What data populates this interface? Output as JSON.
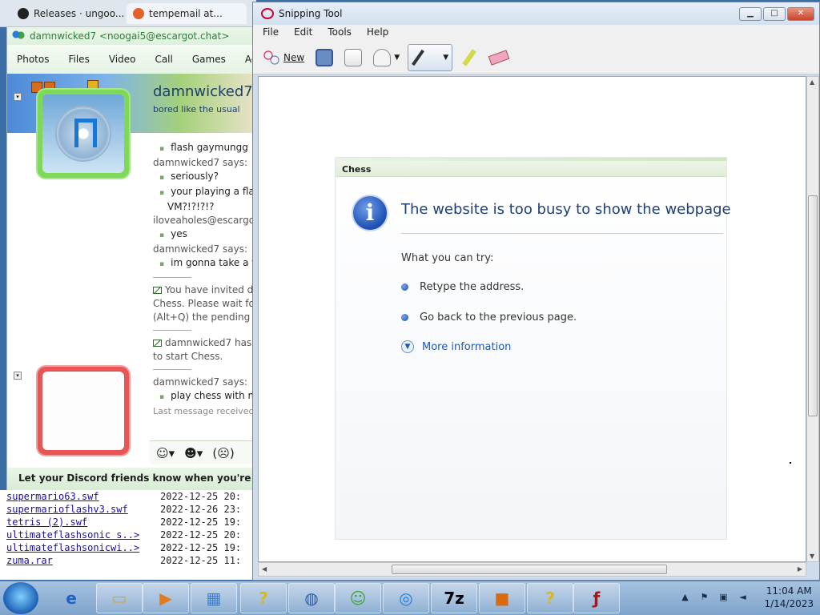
{
  "browser": {
    "tabs": [
      {
        "label": "Releases · ungoo...",
        "icon": "github-icon"
      },
      {
        "label": "tempemail at...",
        "icon": "extension-icon"
      }
    ]
  },
  "messenger": {
    "title": "damnwicked7 <noogai5@escargot.chat>",
    "menu": [
      "Photos",
      "Files",
      "Video",
      "Call",
      "Games",
      "Activ"
    ],
    "display_name": "damnwicked7",
    "status_message": "bored like the usual",
    "chat": [
      {
        "kind": "bullet",
        "text": "flash gaymungg"
      },
      {
        "kind": "sender",
        "text": "damnwicked7 says:"
      },
      {
        "kind": "bullet",
        "text": "seriously?"
      },
      {
        "kind": "bullet",
        "text": "your playing a flas"
      },
      {
        "kind": "cont",
        "text": "VM?!?!?!?"
      },
      {
        "kind": "sender",
        "text": "iloveaholes@escargo"
      },
      {
        "kind": "bullet",
        "text": "yes"
      },
      {
        "kind": "sender",
        "text": "damnwicked7 says:"
      },
      {
        "kind": "bullet",
        "text": "im gonna take a fu"
      },
      {
        "kind": "sep"
      },
      {
        "kind": "system",
        "text": "You have invited d"
      },
      {
        "kind": "syscont",
        "text": "Chess. Please wait for"
      },
      {
        "kind": "syscont",
        "text": "(Alt+Q) the pending i"
      },
      {
        "kind": "sep"
      },
      {
        "kind": "system",
        "text": "damnwicked7 has"
      },
      {
        "kind": "syscont",
        "text": "to start Chess."
      },
      {
        "kind": "sep"
      },
      {
        "kind": "sender",
        "text": "damnwicked7 says:"
      },
      {
        "kind": "bullet",
        "text": "play chess with me"
      },
      {
        "kind": "last",
        "text": "Last message received a"
      }
    ],
    "footer": "Let your Discord friends know when you're on MSN"
  },
  "files": [
    {
      "name": "supermario63.swf",
      "date": "2022-12-25 20:"
    },
    {
      "name": "supermarioflashv3.swf",
      "date": "2022-12-26 23:"
    },
    {
      "name": "tetris (2).swf",
      "date": "2022-12-25 19:"
    },
    {
      "name": "ultimateflashsonic s..>",
      "date": "2022-12-25 20:"
    },
    {
      "name": "ultimateflashsonicwi..>",
      "date": "2022-12-25 19:"
    },
    {
      "name": "zuma.rar",
      "date": "2022-12-25 11:"
    }
  ],
  "snipping_tool": {
    "title": "Snipping Tool",
    "menu": [
      "File",
      "Edit",
      "Tools",
      "Help"
    ],
    "toolbar": {
      "new_label": "New"
    }
  },
  "error_page": {
    "header": "Chess",
    "title": "The website is too busy to show the webpage",
    "subtitle": "What you can try:",
    "items": [
      "Retype the address.",
      "Go back to the previous page."
    ],
    "more": "More information"
  },
  "taskbar": {
    "apps": [
      "internet-explorer",
      "file-explorer",
      "media-player",
      "network-manager",
      "help",
      "app-globe",
      "msn-messenger",
      "chrome",
      "7-zip",
      "roblox",
      "help",
      "flash-player"
    ],
    "time": "11:04 AM",
    "date": "1/14/2023"
  }
}
